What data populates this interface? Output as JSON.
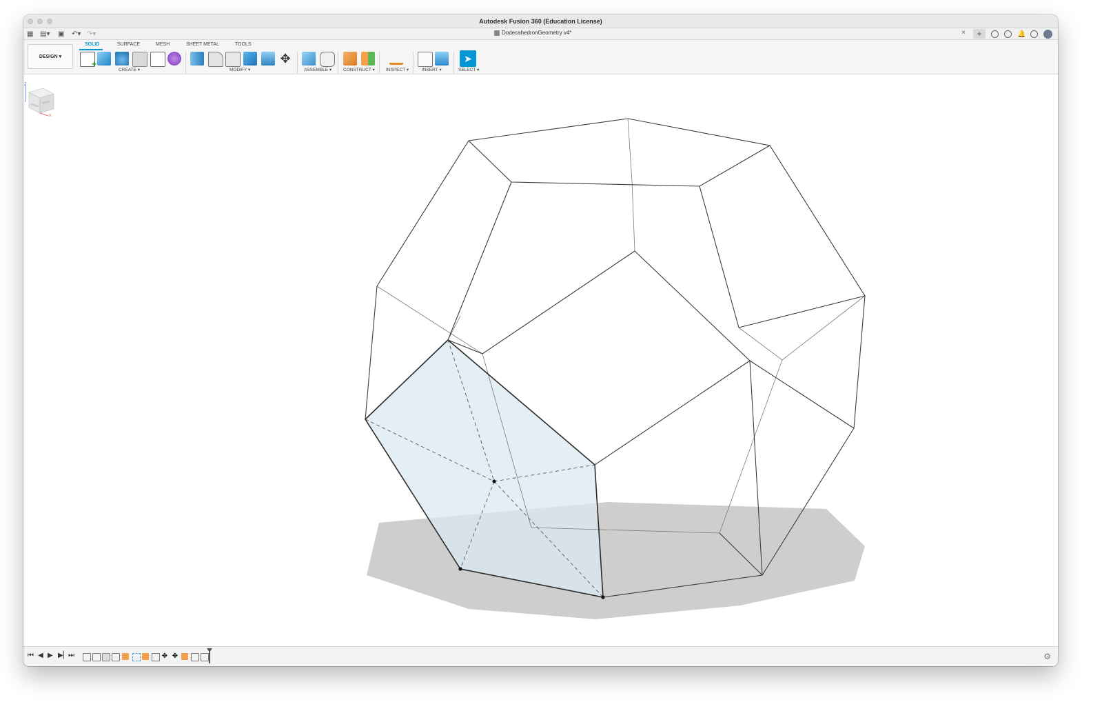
{
  "window": {
    "title": "Autodesk Fusion 360 (Education License)"
  },
  "document": {
    "name": "DodecahedronGeometry v4*"
  },
  "toolbar": {
    "workspace_button": "DESIGN ▾",
    "tabs": [
      "SOLID",
      "SURFACE",
      "MESH",
      "SHEET METAL",
      "TOOLS"
    ],
    "active_tab": "SOLID",
    "groups": {
      "create": "CREATE ▾",
      "modify": "MODIFY ▾",
      "assemble": "ASSEMBLE ▾",
      "construct": "CONSTRUCT ▾",
      "inspect": "INSPECT ▾",
      "insert": "INSERT ▾",
      "select": "SELECT ▾"
    }
  },
  "viewcube": {
    "top": "Z",
    "front": "FRONT",
    "right": "RIGHT",
    "axis_x": "X"
  },
  "timeline": {
    "controls": [
      "⏮",
      "◀",
      "▶",
      "▶▏",
      "⏭"
    ]
  },
  "colors": {
    "accent": "#0696d7",
    "highlight_face": "#dbe9f2",
    "edge": "#3b3b3b",
    "shadow": "#bdbdbd"
  },
  "icons": {
    "apps": "grid-icon",
    "file": "file-icon",
    "save": "save-icon",
    "undo": "undo-icon",
    "redo": "redo-icon",
    "settings": "gear-icon"
  }
}
